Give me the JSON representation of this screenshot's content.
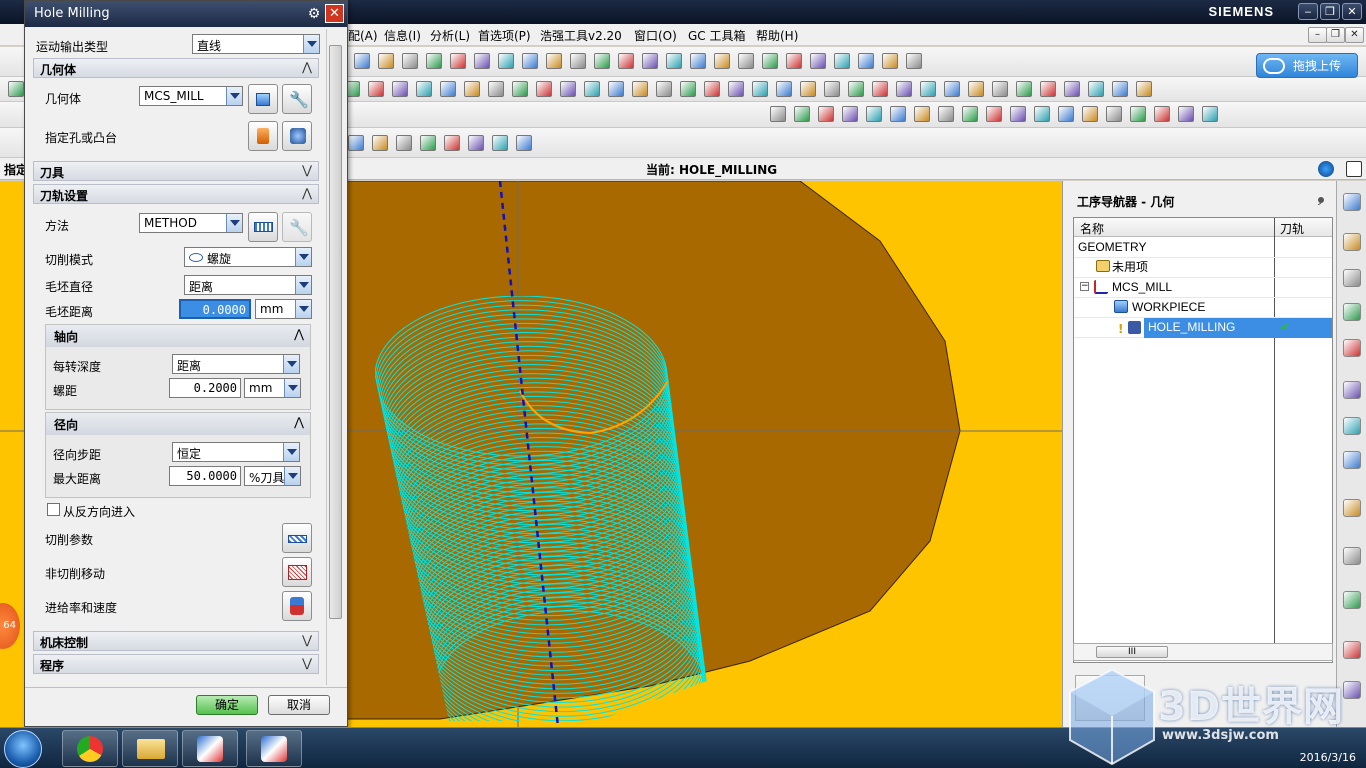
{
  "window": {
    "brand": "SIEMENS"
  },
  "menubar": {
    "items": [
      "配(A)",
      "信息(I)",
      "分析(L)",
      "首选项(P)",
      "浩强工具v2.20",
      "窗口(O)",
      "GC 工具箱",
      "帮助(H)"
    ]
  },
  "toolbar": {
    "share_label": "拖拽上传"
  },
  "statusbar": {
    "prompt": "指定",
    "current": "当前: HOLE_MILLING"
  },
  "dialog": {
    "title": "Hole Milling",
    "motion_output_label": "运动输出类型",
    "motion_output_value": "直线",
    "geometry": {
      "section": "几何体",
      "geometry_label": "几何体",
      "geometry_value": "MCS_MILL",
      "specify_holes_label": "指定孔或凸台"
    },
    "tool_section": "刀具",
    "path_settings": {
      "section": "刀轨设置",
      "method_label": "方法",
      "method_value": "METHOD",
      "cut_pattern_label": "切削模式",
      "cut_pattern_value": "螺旋",
      "blank_diameter_label": "毛坯直径",
      "blank_diameter_value": "距离",
      "blank_distance_label": "毛坯距离",
      "blank_distance_value": "0.0000",
      "blank_distance_unit": "mm"
    },
    "axial": {
      "group": "轴向",
      "depth_per_rev_label": "每转深度",
      "depth_per_rev_value": "距离",
      "pitch_label": "螺距",
      "pitch_value": "0.2000",
      "pitch_unit": "mm"
    },
    "radial": {
      "group": "径向",
      "stepover_label": "径向步距",
      "stepover_value": "恒定",
      "max_distance_label": "最大距离",
      "max_distance_value": "50.0000",
      "max_distance_unit": "%刀具"
    },
    "reverse_entry_label": "从反方向进入",
    "reverse_entry_checked": false,
    "cutting_params_label": "切削参数",
    "non_cutting_label": "非切削移动",
    "feeds_speeds_label": "进给率和速度",
    "machine_control_section": "机床控制",
    "program_section": "程序",
    "ok_label": "确定",
    "cancel_label": "取消"
  },
  "badge": "64",
  "navigator": {
    "title": "工序导航器 - 几何",
    "col_name": "名称",
    "col_toolpath": "刀轨",
    "rows": [
      {
        "label": "GEOMETRY",
        "indent": 0
      },
      {
        "label": "未用项",
        "indent": 1
      },
      {
        "label": "MCS_MILL",
        "indent": 1
      },
      {
        "label": "WORKPIECE",
        "indent": 2
      },
      {
        "label": "HOLE_MILLING",
        "indent": 3,
        "selected": true,
        "toolpath_ok": true
      }
    ]
  },
  "viewport": {
    "background_color": "#ffc400",
    "part_color": "#a86a00",
    "toolpath_color": "#00e5e5",
    "tool_axis_color": "#1010c0"
  },
  "taskbar": {
    "date": "2016/3/16"
  },
  "watermark": {
    "text": "3D世界网",
    "url": "www.3dsjw.com"
  }
}
